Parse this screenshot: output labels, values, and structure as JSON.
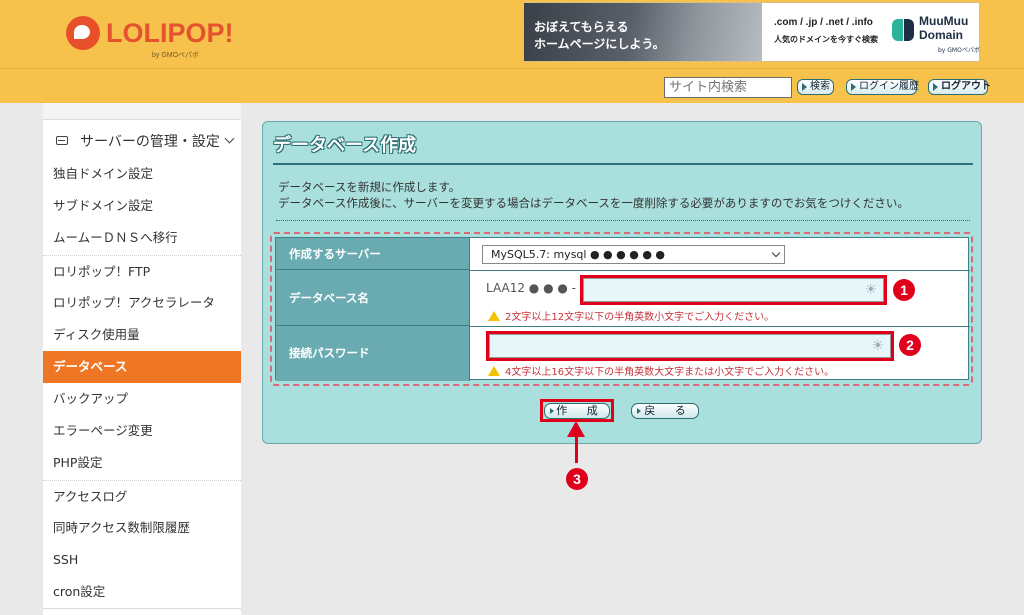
{
  "header": {
    "logo_text": "LOLIPOP!",
    "logo_sub": "by GMOペパボ",
    "banner": {
      "line1": "おぼえてもらえる",
      "line2": "ホームページにしよう。",
      "domains": ".com / .jp / .net / .info",
      "tagline": "人気のドメインを今すぐ検索",
      "brand": "MuuMuu\nDomain",
      "brand_sub": "by GMOペパボ"
    },
    "search_placeholder": "サイト内検索",
    "search_button": "検索",
    "login_history_button": "ログイン履歴",
    "logout_button": "ログアウト"
  },
  "sidebar": {
    "section_label": "サーバーの管理・設定",
    "items": [
      {
        "label": "独自ドメイン設定"
      },
      {
        "label": "サブドメイン設定"
      },
      {
        "label": "ムームーＤＮＳへ移行"
      },
      {
        "label": "ロリポップ！FTP"
      },
      {
        "label": "ロリポップ！アクセラレータ"
      },
      {
        "label": "ディスク使用量"
      },
      {
        "label": "データベース"
      },
      {
        "label": "バックアップ"
      },
      {
        "label": "エラーページ変更"
      },
      {
        "label": "PHP設定"
      },
      {
        "label": "アクセスログ"
      },
      {
        "label": "同時アクセス数制限履歴"
      },
      {
        "label": "SSH"
      },
      {
        "label": "cron設定"
      }
    ],
    "active_item": "データベース"
  },
  "panel": {
    "title": "データベース作成",
    "description_1": "データベースを新規に作成します。",
    "description_2": "データベース作成後に、サーバーを変更する場合はデータベースを一度削除する必要がありますのでお気をつけください。",
    "form": {
      "server_label": "作成するサーバー",
      "server_value": "MySQL5.7: mysql ● ● ● ● ● ●",
      "dbname_label": "データベース名",
      "dbname_prefix": "LAA12 ● ● ●  -",
      "dbname_value": "",
      "dbname_hint": "2文字以上12文字以下の半角英数小文字でご入力ください。",
      "password_label": "接続パスワード",
      "password_value": "",
      "password_hint": "4文字以上16文字以下の半角英数大文字または小文字でご入力ください。"
    },
    "create_button": "作 成",
    "back_button": "戻 る"
  },
  "annotations": {
    "badge1": "1",
    "badge2": "2",
    "badge3": "3",
    "highlight_color": "#e0001b"
  },
  "colors": {
    "header_bg": "#f7c24c",
    "active_nav": "#ef7624",
    "panel_bg": "#a9dfdc",
    "label_bg": "#6aabb2"
  }
}
